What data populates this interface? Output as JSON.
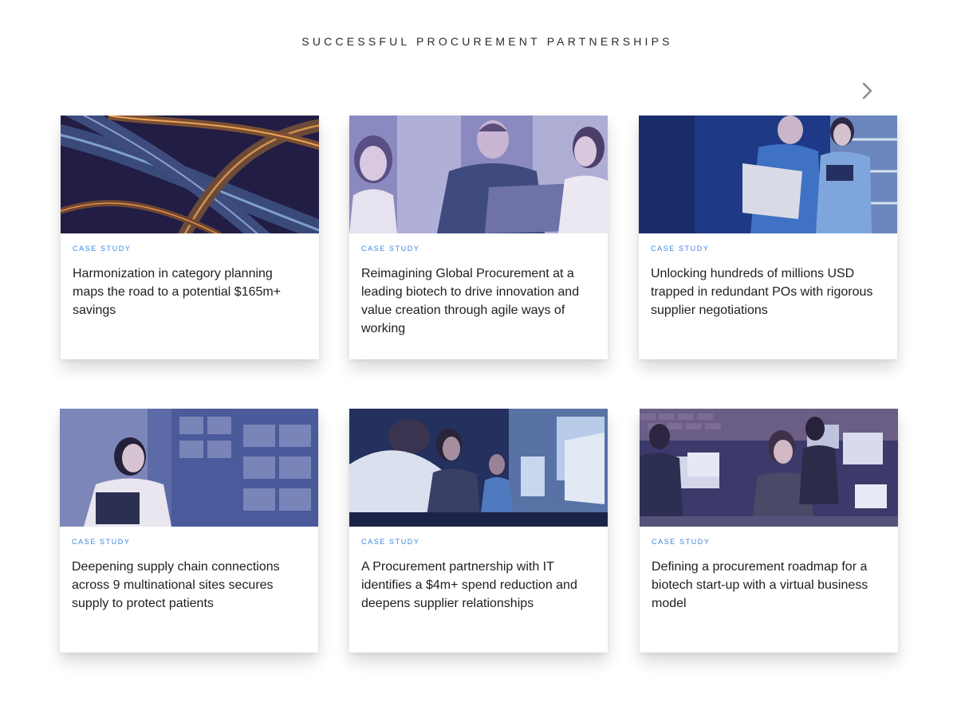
{
  "section": {
    "title": "SUCCESSFUL PROCUREMENT PARTNERSHIPS"
  },
  "icons": {
    "next": "chevron-right-icon"
  },
  "colors": {
    "label": "#3a86e0",
    "text": "#1e1e22",
    "image_tint": "#2a2f7a"
  },
  "cards": [
    {
      "label": "CASE STUDY",
      "title": "Harmonization in category planning maps the road to a potential $165m+ savings",
      "image": "highway-interchange-night"
    },
    {
      "label": "CASE STUDY",
      "title": "Reimagining Global Procurement at a leading biotech to drive innovation and value creation through agile ways of working",
      "image": "colleagues-with-laptop"
    },
    {
      "label": "CASE STUDY",
      "title": "Unlocking hundreds of millions USD trapped in redundant POs with rigorous supplier negotiations",
      "image": "warehouse-workers-with-box"
    },
    {
      "label": "CASE STUDY",
      "title": "Deepening supply chain connections across 9 multinational sites secures supply to protect patients",
      "image": "woman-with-tablet-in-warehouse"
    },
    {
      "label": "CASE STUDY",
      "title": "A Procurement partnership with IT identifies a $4m+ spend reduction and deepens supplier relationships",
      "image": "team-at-computers"
    },
    {
      "label": "CASE STUDY",
      "title": "Defining a procurement roadmap for a biotech start-up with a virtual business model",
      "image": "open-office-workers"
    }
  ]
}
